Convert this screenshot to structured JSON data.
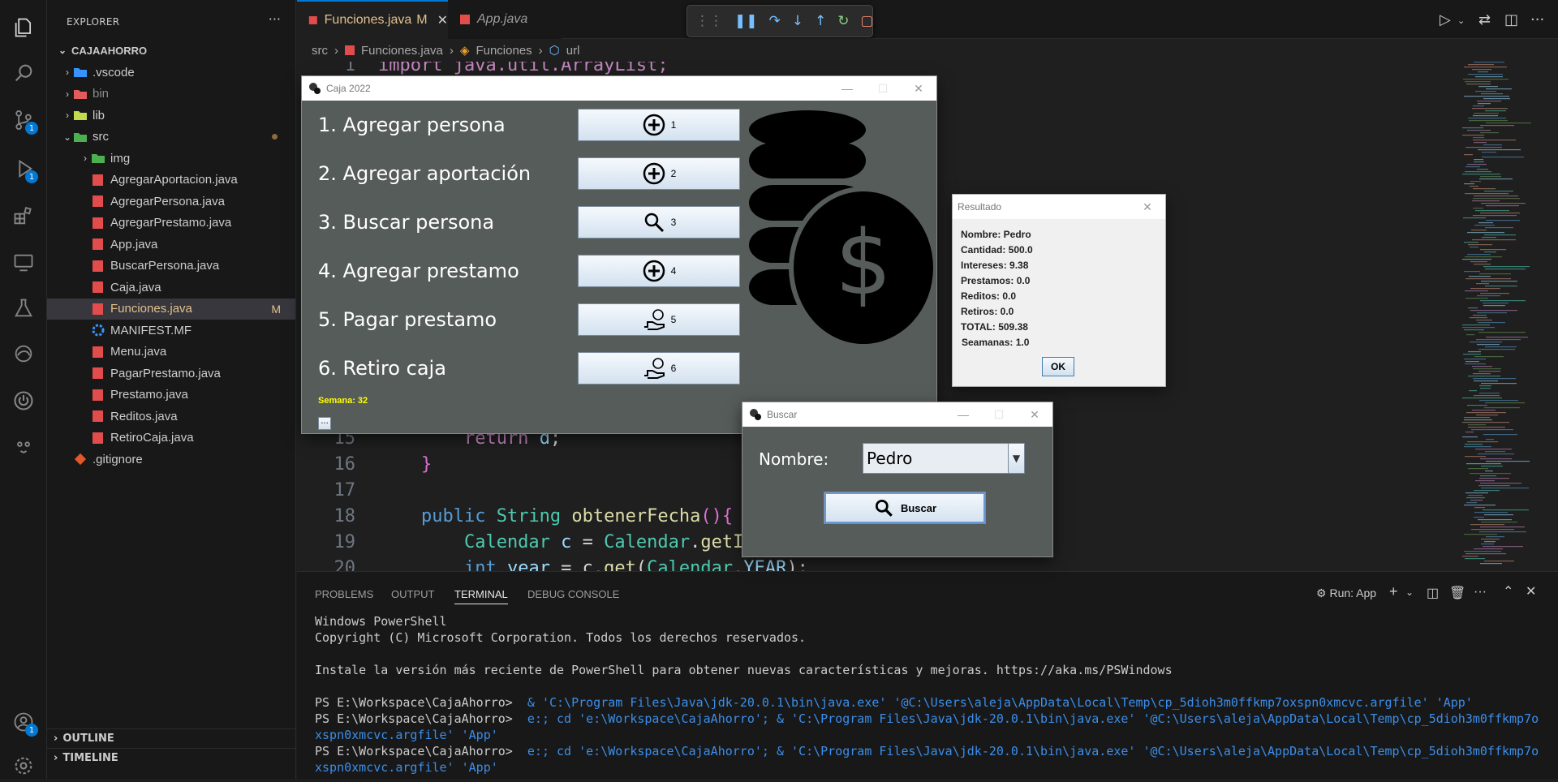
{
  "activity_bar": {
    "source_control_badge": "1",
    "debug_badge": "1",
    "account_badge": "1"
  },
  "sidebar": {
    "title": "EXPLORER",
    "more": "···",
    "root": "CAJAAHORRO",
    "items": [
      {
        "label": ".vscode",
        "type": "folder",
        "color": "#3794ff"
      },
      {
        "label": "bin",
        "type": "folder",
        "color": "#e25c5c"
      },
      {
        "label": "lib",
        "type": "folder",
        "color": "#c3d94e"
      },
      {
        "label": "src",
        "type": "folder",
        "color": "#4caf50"
      },
      {
        "label": "img",
        "type": "folder",
        "color": "#4caf50"
      },
      {
        "label": "AgregarAportacion.java",
        "type": "java"
      },
      {
        "label": "AgregarPersona.java",
        "type": "java"
      },
      {
        "label": "AgregarPrestamo.java",
        "type": "java"
      },
      {
        "label": "App.java",
        "type": "java"
      },
      {
        "label": "BuscarPersona.java",
        "type": "java"
      },
      {
        "label": "Caja.java",
        "type": "java"
      },
      {
        "label": "Funciones.java",
        "type": "java",
        "flag": "M"
      },
      {
        "label": "MANIFEST.MF",
        "type": "gear"
      },
      {
        "label": "Menu.java",
        "type": "java"
      },
      {
        "label": "PagarPrestamo.java",
        "type": "java"
      },
      {
        "label": "Prestamo.java",
        "type": "java"
      },
      {
        "label": "Reditos.java",
        "type": "java"
      },
      {
        "label": "RetiroCaja.java",
        "type": "java"
      },
      {
        "label": ".gitignore",
        "type": "git"
      }
    ],
    "outline": "OUTLINE",
    "timeline": "TIMELINE"
  },
  "tabs": [
    {
      "label": "Funciones.java",
      "flag": "M",
      "close": "✕"
    },
    {
      "label": "App.java"
    }
  ],
  "breadcrumb": [
    "src",
    "Funciones.java",
    "Funciones",
    "url"
  ],
  "editor": {
    "lines": [
      {
        "n": "1",
        "parts": [
          {
            "t": "import java.util.ArrayList;",
            "c": "kw2"
          }
        ]
      },
      {
        "n": "15",
        "parts": [
          {
            "t": "        return ",
            "c": "kw2"
          },
          {
            "t": "d",
            "c": "var"
          },
          {
            "t": ";",
            "c": "txt"
          }
        ]
      },
      {
        "n": "16",
        "parts": [
          {
            "t": "    }",
            "c": "br"
          }
        ]
      },
      {
        "n": "17",
        "parts": []
      },
      {
        "n": "18",
        "parts": [
          {
            "t": "    public ",
            "c": "kw"
          },
          {
            "t": "String ",
            "c": "ty"
          },
          {
            "t": "obtenerFecha",
            "c": "fn"
          },
          {
            "t": "(){",
            "c": "br"
          }
        ]
      },
      {
        "n": "19",
        "parts": [
          {
            "t": "        Calendar ",
            "c": "ty"
          },
          {
            "t": "c",
            "c": "var"
          },
          {
            "t": " = ",
            "c": "txt"
          },
          {
            "t": "Calendar",
            "c": "ty"
          },
          {
            "t": ".",
            "c": "txt"
          },
          {
            "t": "getI",
            "c": "fn"
          }
        ]
      },
      {
        "n": "20",
        "parts": [
          {
            "t": "        int ",
            "c": "kw"
          },
          {
            "t": "year",
            "c": "var"
          },
          {
            "t": " = c.",
            "c": "txt"
          },
          {
            "t": "get",
            "c": "fn"
          },
          {
            "t": "(",
            "c": "txt"
          },
          {
            "t": "Calendar",
            "c": "ty"
          },
          {
            "t": ".",
            "c": "txt"
          },
          {
            "t": "YEAR",
            "c": "var"
          },
          {
            "t": ");",
            "c": "txt"
          }
        ]
      }
    ]
  },
  "panel": {
    "tabs": [
      "PROBLEMS",
      "OUTPUT",
      "TERMINAL",
      "DEBUG CONSOLE"
    ],
    "run_label": "Run: App",
    "terminal": [
      "Windows PowerShell",
      "Copyright (C) Microsoft Corporation. Todos los derechos reservados.",
      "",
      "Instale la versión más reciente de PowerShell para obtener nuevas características y mejoras. https://aka.ms/PSWindows",
      "",
      "PS E:\\Workspace\\CajaAhorro>  & 'C:\\Program Files\\Java\\jdk-20.0.1\\bin\\java.exe' '@C:\\Users\\aleja\\AppData\\Local\\Temp\\cp_5dioh3m0ffkmp7oxspn0xmcvc.argfile' 'App'",
      "PS E:\\Workspace\\CajaAhorro>  e:; cd 'e:\\Workspace\\CajaAhorro'; & 'C:\\Program Files\\Java\\jdk-20.0.1\\bin\\java.exe' '@C:\\Users\\aleja\\AppData\\Local\\Temp\\cp_5dioh3m0ffkmp7o",
      "xspn0xmcvc.argfile' 'App'",
      "PS E:\\Workspace\\CajaAhorro>  e:; cd 'e:\\Workspace\\CajaAhorro'; & 'C:\\Program Files\\Java\\jdk-20.0.1\\bin\\java.exe' '@C:\\Users\\aleja\\AppData\\Local\\Temp\\cp_5dioh3m0ffkmp7o",
      "xspn0xmcvc.argfile' 'App'"
    ]
  },
  "caja_window": {
    "title": "Caja 2022",
    "options": [
      {
        "label": "1. Agregar persona",
        "btn": "1",
        "icon": "plus"
      },
      {
        "label": "2. Agregar aportación",
        "btn": "2",
        "icon": "plus"
      },
      {
        "label": "3. Buscar persona",
        "btn": "3",
        "icon": "search"
      },
      {
        "label": "4. Agregar prestamo",
        "btn": "4",
        "icon": "plus"
      },
      {
        "label": "5. Pagar prestamo",
        "btn": "5",
        "icon": "hand-coin"
      },
      {
        "label": "6. Retiro caja",
        "btn": "6",
        "icon": "hand-coin"
      }
    ],
    "semana": "Semana: 32",
    "more_btn": "..."
  },
  "resultado_window": {
    "title": "Resultado",
    "lines": [
      "Nombre: Pedro",
      "Cantidad: 500.0",
      "Intereses: 9.38",
      "Prestamos: 0.0",
      "Reditos: 0.0",
      "Retiros: 0.0",
      "TOTAL: 509.38",
      "Seamanas: 1.0"
    ],
    "ok": "OK"
  },
  "buscar_window": {
    "title": "Buscar",
    "label": "Nombre:",
    "value": "Pedro",
    "button": "Buscar"
  }
}
